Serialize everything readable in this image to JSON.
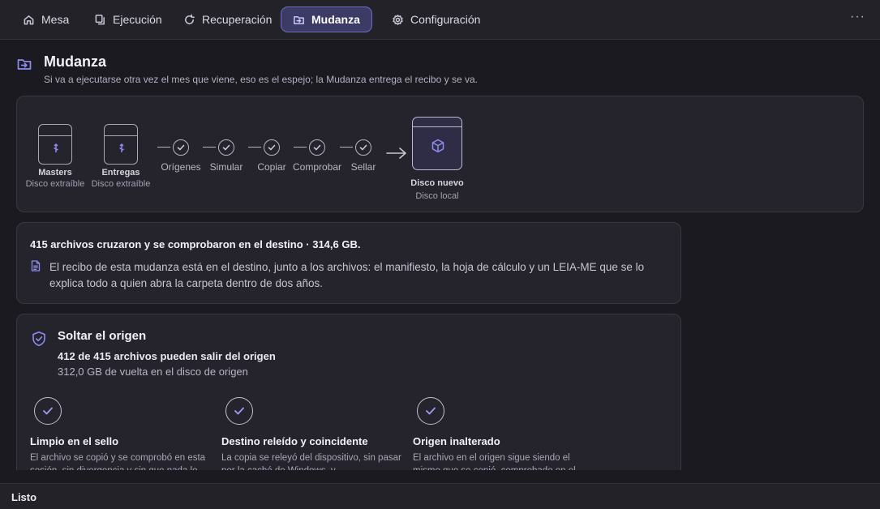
{
  "nav": {
    "tabs": [
      {
        "label": "Mesa",
        "icon": "home-icon"
      },
      {
        "label": "Ejecución",
        "icon": "copy-icon"
      },
      {
        "label": "Recuperación",
        "icon": "refresh-icon"
      },
      {
        "label": "Mudanza",
        "icon": "folder-move-icon",
        "active": true
      },
      {
        "label": "Configuración",
        "icon": "settings-icon"
      }
    ],
    "more": "···"
  },
  "page": {
    "title": "Mudanza",
    "subtitle": "Si va a ejecutarse otra vez el mes que viene, eso es el espejo; la Mudanza entrega el recibo y se va."
  },
  "pipeline": {
    "sources": [
      {
        "label": "Masters",
        "sub": "Disco extraíble",
        "icon": "usb-icon"
      },
      {
        "label": "Entregas",
        "sub": "Disco extraíble",
        "icon": "usb-icon"
      }
    ],
    "steps": [
      "Orígenes",
      "Simular",
      "Copiar",
      "Comprobar",
      "Sellar"
    ],
    "destination": {
      "label": "Disco nuevo",
      "sub": "Disco local",
      "icon": "cube-icon"
    }
  },
  "summary": {
    "headline": "415 archivos cruzaron y se comprobaron en el destino · 314,6 GB.",
    "receipt": "El recibo de esta mudanza está en el destino, junto a los archivos: el manifiesto, la hoja de cálculo y un LEIA-ME que se lo explica todo a quien abra la carpeta dentro de dos años."
  },
  "release": {
    "title": "Soltar el origen",
    "count": "412 de 415 archivos pueden salir del origen",
    "gb": "312,0 GB de vuelta en el disco de origen",
    "checks": [
      {
        "title": "Limpio en el sello",
        "desc": "El archivo se copió y se comprobó en esta sesión, sin divergencia y sin que nada lo"
      },
      {
        "title": "Destino releído y coincidente",
        "desc": "La copia se releyó del dispositivo, sin pasar por la caché de Windows, y"
      },
      {
        "title": "Origen inalterado",
        "desc": "El archivo en el origen sigue siendo el mismo que se copió, comprobado en el"
      }
    ]
  },
  "status": {
    "text": "Listo"
  },
  "colors": {
    "accent": "#8e8cf0",
    "background": "#1b1a20",
    "card": "#25242c"
  }
}
